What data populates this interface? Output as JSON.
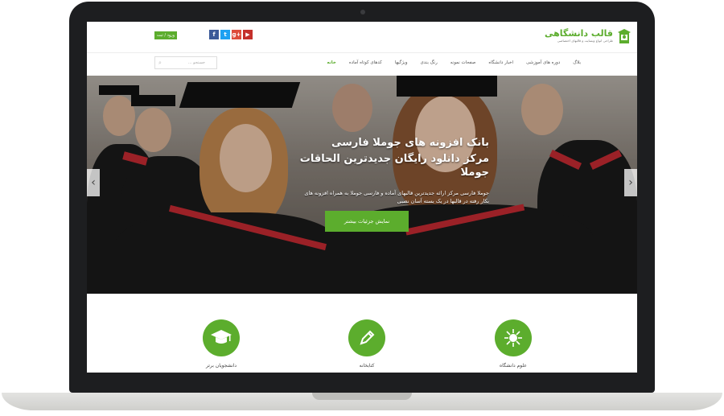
{
  "header": {
    "login_label": "ورود / ثبت",
    "social": [
      {
        "name": "facebook",
        "glyph": "f",
        "color": "#3b5998"
      },
      {
        "name": "twitter",
        "glyph": "t",
        "color": "#1da1f2"
      },
      {
        "name": "google-plus",
        "glyph": "g+",
        "color": "#dd4b39"
      },
      {
        "name": "youtube",
        "glyph": "▶",
        "color": "#c4302b"
      }
    ],
    "logo_title": "قالب دانشگاهی",
    "logo_subtitle": "طراحی انواع وبسایت و قالبهای اختصاصی"
  },
  "nav": {
    "search_placeholder": "جستجو ...",
    "items": [
      {
        "label": "خانه",
        "active": true
      },
      {
        "label": "کدهای کوتاه آماده",
        "active": false
      },
      {
        "label": "ویژگیها",
        "active": false
      },
      {
        "label": "رنگ بندی",
        "active": false
      },
      {
        "label": "صفحات نمونه",
        "active": false
      },
      {
        "label": "اخبار دانشگاه",
        "active": false
      },
      {
        "label": "دوره های آموزشی",
        "active": false
      },
      {
        "label": "بلاگ",
        "active": false
      }
    ]
  },
  "hero": {
    "title_line1": "بانک افزونه های جوملا فارسی",
    "title_line2": "مرکز دانلود رایگان جدیدترین الحاقات جوملا",
    "description": "جوملا فارسی مرکز ارائه جدیدترین قالبهای آماده و فارسی جوملا به همراه افزونه های بکار رفته در قالبها در یک بسته آسان نصبی",
    "button_label": "نمایش جزئیات بیشتر"
  },
  "features": [
    {
      "icon": "graduation-cap-icon",
      "label": "دانشجویان برتر"
    },
    {
      "icon": "pencil-icon",
      "label": "کتابخانه"
    },
    {
      "icon": "virus-icon",
      "label": "علوم دانشگاه"
    }
  ],
  "colors": {
    "accent": "#5cad2d",
    "frame": "#1d1e20"
  }
}
